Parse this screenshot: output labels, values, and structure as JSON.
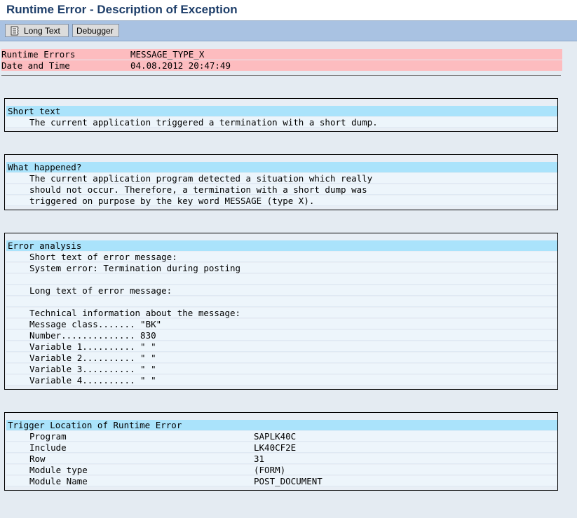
{
  "window": {
    "title": "Runtime Error - Description of Exception"
  },
  "toolbar": {
    "long_text_label": "Long Text",
    "debugger_label": "Debugger"
  },
  "header": {
    "runtime_errors_label": "Runtime Errors",
    "runtime_errors_value": "MESSAGE_TYPE_X",
    "date_time_label": "Date and Time",
    "date_time_value": "04.08.2012 20:47:49"
  },
  "short_text": {
    "heading": "Short text",
    "lines": [
      "The current application triggered a termination with a short dump."
    ]
  },
  "what_happened": {
    "heading": "What happened?",
    "lines": [
      "The current application program detected a situation which really",
      "should not occur. Therefore, a termination with a short dump was",
      "triggered on purpose by the key word MESSAGE (type X)."
    ]
  },
  "error_analysis": {
    "heading": "Error analysis",
    "lines": [
      "Short text of error message:",
      "System error: Termination during posting",
      "",
      "Long text of error message:",
      "",
      "Technical information about the message:",
      "Message class....... \"BK\"",
      "Number.............. 830",
      "Variable 1.......... \" \"",
      "Variable 2.......... \" \"",
      "Variable 3.......... \" \"",
      "Variable 4.......... \" \""
    ]
  },
  "trigger_location": {
    "heading": "Trigger Location of Runtime Error",
    "rows": [
      {
        "label": "Program",
        "value": "SAPLK40C"
      },
      {
        "label": "Include",
        "value": "LK40CF2E"
      },
      {
        "label": "Row",
        "value": "31"
      },
      {
        "label": "Module type",
        "value": "(FORM)"
      },
      {
        "label": "Module Name",
        "value": "POST_DOCUMENT"
      }
    ]
  }
}
